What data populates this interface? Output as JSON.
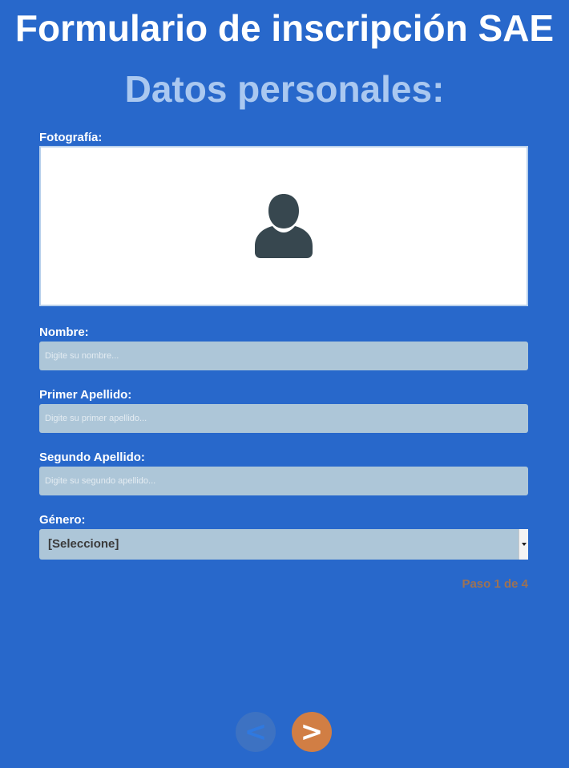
{
  "header": {
    "title": "Formulario de inscripción SAE",
    "section_title": "Datos personales:"
  },
  "form": {
    "photo_label": "Fotografía:",
    "photo_icon": "user-silhouette-icon",
    "name_label": "Nombre:",
    "name_placeholder": "Digite su nombre...",
    "name_value": "",
    "first_surname_label": "Primer Apellido:",
    "first_surname_placeholder": "Digite su primer apellido...",
    "first_surname_value": "",
    "second_surname_label": "Segundo Apellido:",
    "second_surname_placeholder": "Digite su segundo apellido...",
    "second_surname_value": "",
    "gender_label": "Género:",
    "gender_selected": "[Seleccione]"
  },
  "footer": {
    "step_text": "Paso 1 de 4",
    "prev_label": "<",
    "next_label": ">"
  },
  "colors": {
    "background": "#2868cb",
    "section_title": "#aac8f0",
    "input_bg": "#adc6d8",
    "step_text": "#9c7255",
    "next_button": "#d17e44",
    "prev_button": "#3d72c2"
  }
}
